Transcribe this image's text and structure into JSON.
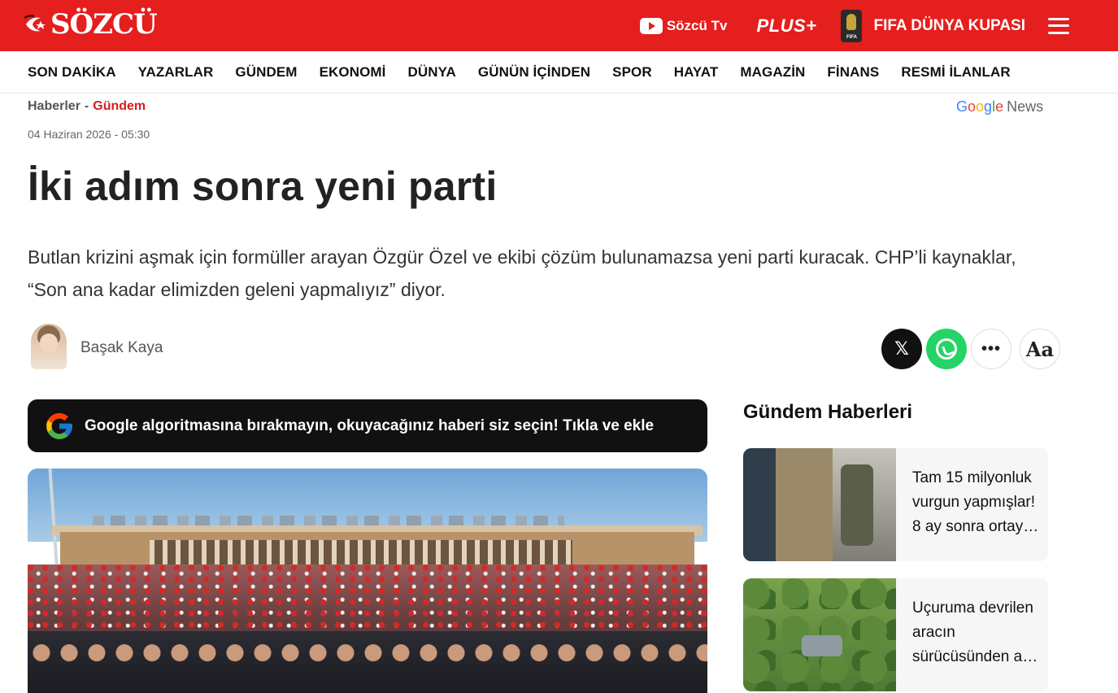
{
  "header": {
    "logo_text": "SÖZCÜ",
    "sozcu_tv_label": "Sözcü Tv",
    "plus_label": "PLUS+",
    "fifa_label": "FIFA DÜNYA KUPASI",
    "fifa_icon_text": "FIFA"
  },
  "nav": {
    "items": [
      "SON DAKİKA",
      "YAZARLAR",
      "GÜNDEM",
      "EKONOMİ",
      "DÜNYA",
      "GÜNÜN İÇİNDEN",
      "SPOR",
      "HAYAT",
      "MAGAZİN",
      "FİNANS",
      "RESMİ İLANLAR"
    ]
  },
  "breadcrumb": {
    "root": "Haberler",
    "separator": "-",
    "current": "Gündem"
  },
  "google_news": {
    "google": "Google",
    "news": "News",
    "colors": [
      "#4285f4",
      "#ea4335",
      "#fbbc05",
      "#4285f4",
      "#34a853",
      "#ea4335"
    ]
  },
  "article": {
    "date": "04 Haziran 2026 - 05:30",
    "title": "İki adım sonra yeni parti",
    "lead": "Butlan krizini aşmak için formüller arayan Özgür Özel ve ekibi çözüm bulunamazsa yeni parti kuracak. CHP’li kaynaklar, “Son ana kadar elimizden geleni yapmalıyız” diyor.",
    "author": "Başak Kaya"
  },
  "share": {
    "x_label": "𝕏",
    "more_label": "•••",
    "font_label": "Aa"
  },
  "google_banner": {
    "text": "Google algoritmasına bırakmayın, okuyacağınız haberi siz seçin! Tıkla ve ekle"
  },
  "sidebar": {
    "title": "Gündem Haberleri",
    "cards": [
      {
        "text": "Tam 15 milyonluk vurgun yapmışlar! 8 ay sonra ortay…"
      },
      {
        "text": "Uçuruma devrilen aracın sürücüsünden a…"
      }
    ]
  },
  "colors": {
    "brand_red": "#e51e1e",
    "breadcrumb_active": "#d91c1c",
    "whatsapp": "#25d366"
  }
}
